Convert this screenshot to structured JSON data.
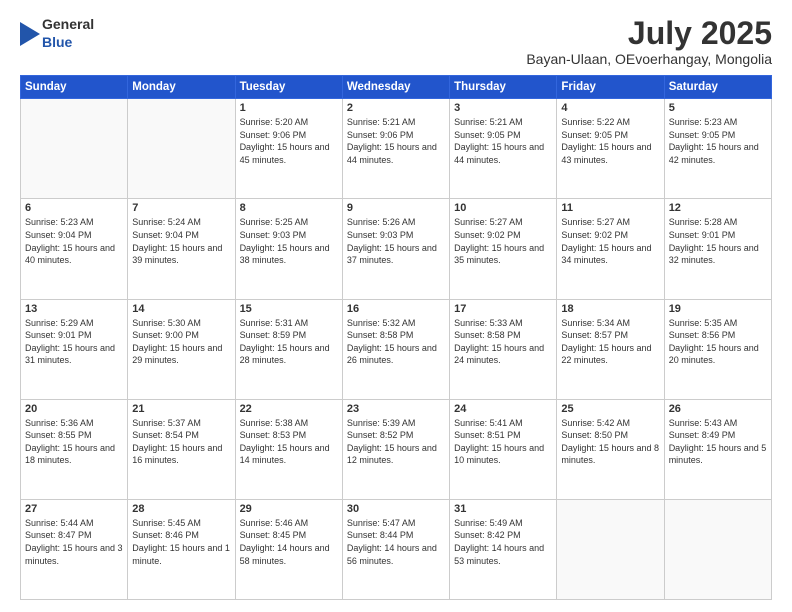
{
  "header": {
    "logo_general": "General",
    "logo_blue": "Blue",
    "month": "July 2025",
    "location": "Bayan-Ulaan, OEvoerhangay, Mongolia"
  },
  "weekdays": [
    "Sunday",
    "Monday",
    "Tuesday",
    "Wednesday",
    "Thursday",
    "Friday",
    "Saturday"
  ],
  "weeks": [
    [
      {
        "day": "",
        "info": ""
      },
      {
        "day": "",
        "info": ""
      },
      {
        "day": "1",
        "info": "Sunrise: 5:20 AM\nSunset: 9:06 PM\nDaylight: 15 hours and 45 minutes."
      },
      {
        "day": "2",
        "info": "Sunrise: 5:21 AM\nSunset: 9:06 PM\nDaylight: 15 hours and 44 minutes."
      },
      {
        "day": "3",
        "info": "Sunrise: 5:21 AM\nSunset: 9:05 PM\nDaylight: 15 hours and 44 minutes."
      },
      {
        "day": "4",
        "info": "Sunrise: 5:22 AM\nSunset: 9:05 PM\nDaylight: 15 hours and 43 minutes."
      },
      {
        "day": "5",
        "info": "Sunrise: 5:23 AM\nSunset: 9:05 PM\nDaylight: 15 hours and 42 minutes."
      }
    ],
    [
      {
        "day": "6",
        "info": "Sunrise: 5:23 AM\nSunset: 9:04 PM\nDaylight: 15 hours and 40 minutes."
      },
      {
        "day": "7",
        "info": "Sunrise: 5:24 AM\nSunset: 9:04 PM\nDaylight: 15 hours and 39 minutes."
      },
      {
        "day": "8",
        "info": "Sunrise: 5:25 AM\nSunset: 9:03 PM\nDaylight: 15 hours and 38 minutes."
      },
      {
        "day": "9",
        "info": "Sunrise: 5:26 AM\nSunset: 9:03 PM\nDaylight: 15 hours and 37 minutes."
      },
      {
        "day": "10",
        "info": "Sunrise: 5:27 AM\nSunset: 9:02 PM\nDaylight: 15 hours and 35 minutes."
      },
      {
        "day": "11",
        "info": "Sunrise: 5:27 AM\nSunset: 9:02 PM\nDaylight: 15 hours and 34 minutes."
      },
      {
        "day": "12",
        "info": "Sunrise: 5:28 AM\nSunset: 9:01 PM\nDaylight: 15 hours and 32 minutes."
      }
    ],
    [
      {
        "day": "13",
        "info": "Sunrise: 5:29 AM\nSunset: 9:01 PM\nDaylight: 15 hours and 31 minutes."
      },
      {
        "day": "14",
        "info": "Sunrise: 5:30 AM\nSunset: 9:00 PM\nDaylight: 15 hours and 29 minutes."
      },
      {
        "day": "15",
        "info": "Sunrise: 5:31 AM\nSunset: 8:59 PM\nDaylight: 15 hours and 28 minutes."
      },
      {
        "day": "16",
        "info": "Sunrise: 5:32 AM\nSunset: 8:58 PM\nDaylight: 15 hours and 26 minutes."
      },
      {
        "day": "17",
        "info": "Sunrise: 5:33 AM\nSunset: 8:58 PM\nDaylight: 15 hours and 24 minutes."
      },
      {
        "day": "18",
        "info": "Sunrise: 5:34 AM\nSunset: 8:57 PM\nDaylight: 15 hours and 22 minutes."
      },
      {
        "day": "19",
        "info": "Sunrise: 5:35 AM\nSunset: 8:56 PM\nDaylight: 15 hours and 20 minutes."
      }
    ],
    [
      {
        "day": "20",
        "info": "Sunrise: 5:36 AM\nSunset: 8:55 PM\nDaylight: 15 hours and 18 minutes."
      },
      {
        "day": "21",
        "info": "Sunrise: 5:37 AM\nSunset: 8:54 PM\nDaylight: 15 hours and 16 minutes."
      },
      {
        "day": "22",
        "info": "Sunrise: 5:38 AM\nSunset: 8:53 PM\nDaylight: 15 hours and 14 minutes."
      },
      {
        "day": "23",
        "info": "Sunrise: 5:39 AM\nSunset: 8:52 PM\nDaylight: 15 hours and 12 minutes."
      },
      {
        "day": "24",
        "info": "Sunrise: 5:41 AM\nSunset: 8:51 PM\nDaylight: 15 hours and 10 minutes."
      },
      {
        "day": "25",
        "info": "Sunrise: 5:42 AM\nSunset: 8:50 PM\nDaylight: 15 hours and 8 minutes."
      },
      {
        "day": "26",
        "info": "Sunrise: 5:43 AM\nSunset: 8:49 PM\nDaylight: 15 hours and 5 minutes."
      }
    ],
    [
      {
        "day": "27",
        "info": "Sunrise: 5:44 AM\nSunset: 8:47 PM\nDaylight: 15 hours and 3 minutes."
      },
      {
        "day": "28",
        "info": "Sunrise: 5:45 AM\nSunset: 8:46 PM\nDaylight: 15 hours and 1 minute."
      },
      {
        "day": "29",
        "info": "Sunrise: 5:46 AM\nSunset: 8:45 PM\nDaylight: 14 hours and 58 minutes."
      },
      {
        "day": "30",
        "info": "Sunrise: 5:47 AM\nSunset: 8:44 PM\nDaylight: 14 hours and 56 minutes."
      },
      {
        "day": "31",
        "info": "Sunrise: 5:49 AM\nSunset: 8:42 PM\nDaylight: 14 hours and 53 minutes."
      },
      {
        "day": "",
        "info": ""
      },
      {
        "day": "",
        "info": ""
      }
    ]
  ]
}
